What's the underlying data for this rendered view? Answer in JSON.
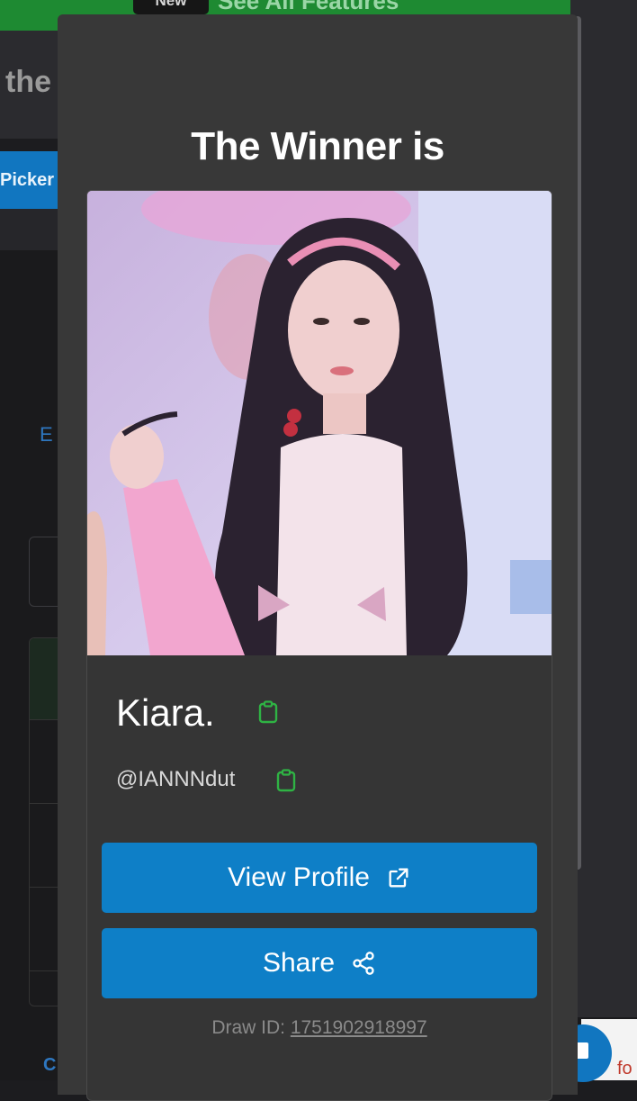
{
  "background": {
    "banner_badge": "New",
    "banner_text": "See All Features",
    "page_title": "the",
    "tab_label": "Picker",
    "link_fragment": "E",
    "bottom_fragment": "C",
    "ad_fragment": "fo"
  },
  "modal": {
    "title": "The Winner is",
    "winner": {
      "name": "Kiara.",
      "handle": "@IANNNdut"
    },
    "buttons": {
      "view_profile": "View Profile",
      "share": "Share"
    },
    "draw": {
      "label": "Draw ID: ",
      "value": "1751902918997"
    }
  },
  "colors": {
    "accent_button": "#0e7fc7",
    "copy_icon": "#2fb344",
    "modal_bg": "#383838",
    "banner": "#1e8a32"
  },
  "icons": {
    "copy": "clipboard-icon",
    "external": "external-link-icon",
    "share": "share-icon"
  }
}
